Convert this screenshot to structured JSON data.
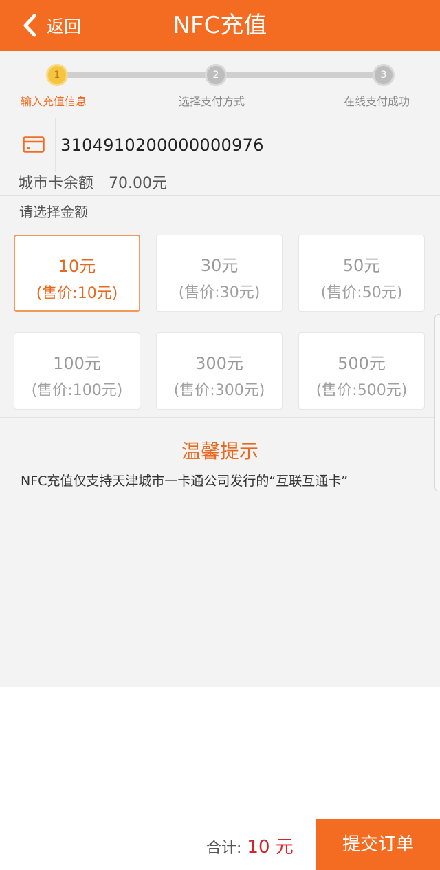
{
  "header": {
    "back_label": "返回",
    "title": "NFC充值"
  },
  "steps": [
    {
      "number": "1",
      "label": "输入充值信息",
      "active": true
    },
    {
      "number": "2",
      "label": "选择支付方式",
      "active": false
    },
    {
      "number": "3",
      "label": "在线支付成功",
      "active": false
    }
  ],
  "card": {
    "icon": "card-icon",
    "number": "3104910200000000976"
  },
  "balance": {
    "label": "城市卡余额",
    "amount": "70.00元"
  },
  "amount_section": {
    "label": "请选择金额",
    "options": [
      {
        "value": "10元",
        "price": "(售价:10元)",
        "selected": true
      },
      {
        "value": "30元",
        "price": "(售价:30元)",
        "selected": false
      },
      {
        "value": "50元",
        "price": "(售价:50元)",
        "selected": false
      },
      {
        "value": "100元",
        "price": "(售价:100元)",
        "selected": false
      },
      {
        "value": "300元",
        "price": "(售价:300元)",
        "selected": false
      },
      {
        "value": "500元",
        "price": "(售价:500元)",
        "selected": false
      }
    ]
  },
  "tip": {
    "title": "温馨提示",
    "text": "NFC充值仅支持天津城市一卡通公司发行的“互联互通卡”"
  },
  "footer": {
    "total_label": "合计:",
    "total_value": "10 元",
    "submit_label": "提交订单"
  },
  "colors": {
    "accent": "#f36c21",
    "total_red": "#d4242a",
    "step_active": "#f6c43e"
  }
}
